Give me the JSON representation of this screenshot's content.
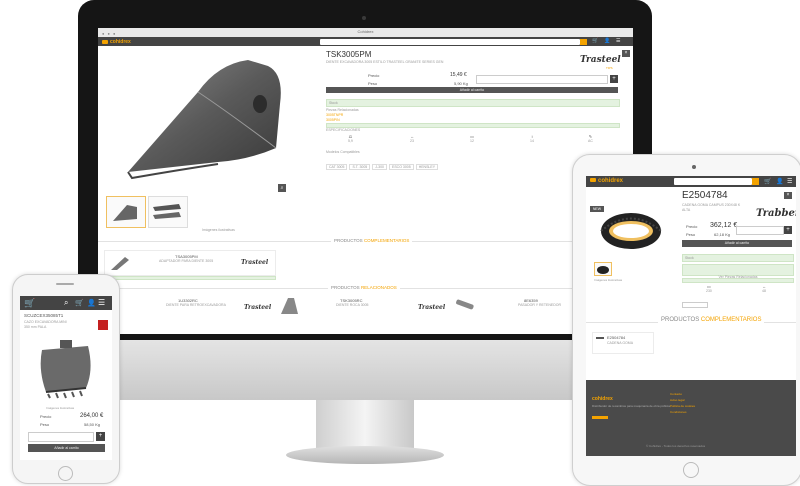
{
  "desktop": {
    "browser_title": "Cohidrex",
    "brand": "cohidrex",
    "search_placeholder": "",
    "product": {
      "code": "TSK3005PM",
      "subtitle": "DIENTE EXCAVADORA 3005 ESTILO TRASTEEL GRANITE SERIES GEN",
      "brand": "Trasteel",
      "brand_tag": "TIPS",
      "price_label": "Precio",
      "price": "15,49 €",
      "weight_label": "Peso",
      "weight": "5,90 Kg",
      "add_button": "Añadir al carrito",
      "stock_label": "Stock",
      "stock_value": "",
      "related_label": "Piezas Relacionadas",
      "related": [
        "3005TNPR",
        "3005PIN"
      ],
      "specs_label": "ESPECIFICACIONES",
      "specs": [
        {
          "label": "Peso",
          "value": "5,9"
        },
        {
          "label": "Longitud",
          "value": "23"
        },
        {
          "label": "Ancho",
          "value": "12"
        },
        {
          "label": "Alto",
          "value": "14"
        },
        {
          "label": "Material",
          "value": "AC"
        }
      ],
      "tags_label": "Modelos Compatibles",
      "tags": [
        "CAT 3005",
        "S.T. 3005",
        "J-300",
        "ESCO 3005",
        "HENSLEY"
      ],
      "thumb_caption": "Imágenes ilustrativas"
    },
    "section_accessories": {
      "prefix": "PRODUCTOS",
      "highlight": "COMPLEMENTARIOS"
    },
    "accessory": {
      "code": "TSA3005PM",
      "desc": "ADAPTADOR PARA DIENTE 3005",
      "brand": "Trasteel"
    },
    "section_related": {
      "prefix": "PRODUCTOS",
      "highlight": "RELACIONADOS"
    },
    "related_items": [
      {
        "code": "1U3302RC",
        "desc": "DIENTE PARA RETROEXCAVADORA",
        "brand": "Trasteel"
      },
      {
        "code": "TSK3005RC",
        "desc": "DIENTE ROCA 3005",
        "brand": "Trasteel"
      },
      {
        "code": "8E6359",
        "desc": "PASADOR Y RETENEDOR",
        "brand": ""
      }
    ]
  },
  "tablet": {
    "brand": "cohidrex",
    "product": {
      "code": "E2504784",
      "subtitle": "CADENA GOMA CAMPUS 230X48 K",
      "subtitle2": "ALTA",
      "brand": "Trabber",
      "price_label": "Precio",
      "price": "362,12 €",
      "weight_label": "Peso",
      "weight": "62,18 Kg",
      "add_button": "Añadir al carrito",
      "stock_label": "Stock",
      "consult_button": "Ver Piezas Relacionadas",
      "specs": [
        {
          "label": "Ancho",
          "value": "230"
        },
        {
          "label": "Paso",
          "value": "48"
        }
      ],
      "thumb_caption": "Imágenes ilustrativas",
      "new_badge": "NEW"
    },
    "section": {
      "prefix": "PRODUCTOS",
      "highlight": "COMPLEMENTARIOS"
    },
    "complementary": {
      "code": "E2504784",
      "desc": "CADENA GOMA"
    },
    "footer": {
      "brand": "cohidrex",
      "about": "Distribuidor de recambios para maquinaria de obra pública",
      "links": [
        "Contacto",
        "Aviso legal",
        "Política de cookies",
        "Condiciones"
      ],
      "copyright": "© Cohidrex - Todos los derechos reservados"
    }
  },
  "phone": {
    "product": {
      "code": "SCUZCEX35085T1",
      "subtitle": "CAZO EXCAVADORA MINI",
      "subtitle2": "350 mm PALA",
      "image_caption": "Imágenes ilustrativas",
      "price_label": "Precio",
      "price": "264,00 €",
      "weight_label": "Peso",
      "weight": "58,50 Kg",
      "add_button": "Añadir al carrito"
    }
  },
  "colors": {
    "accent": "#f4a300",
    "nav": "#444444",
    "stock": "#e4f2e0"
  }
}
